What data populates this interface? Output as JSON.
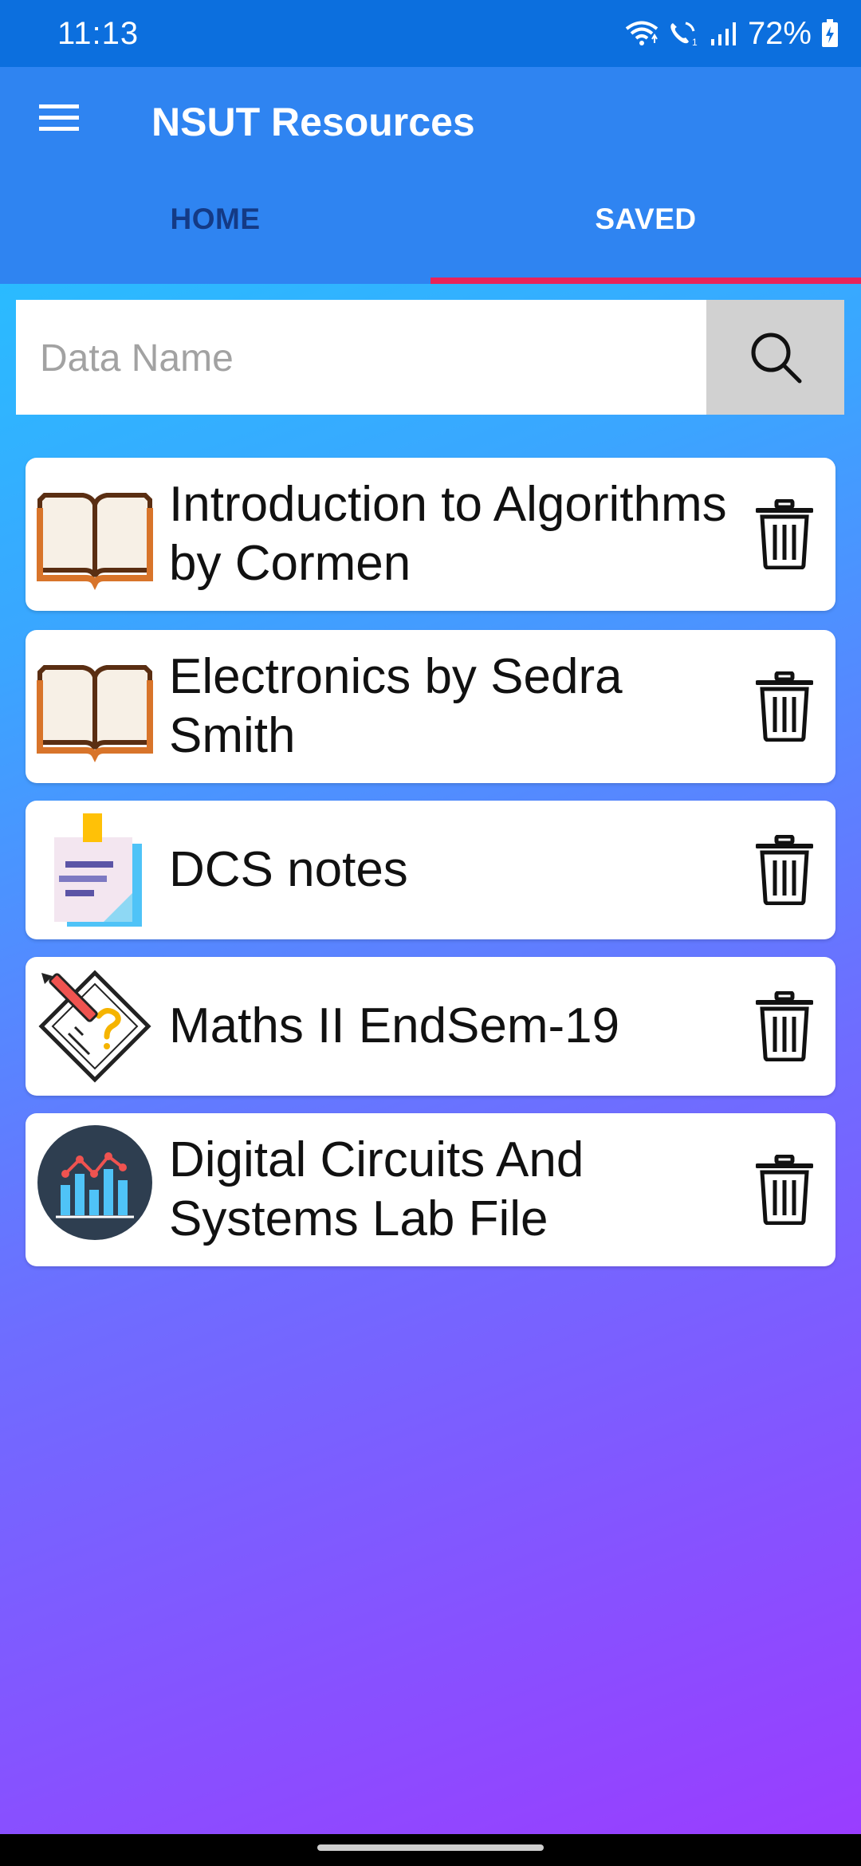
{
  "status_bar": {
    "time": "11:13",
    "battery": "72%",
    "icons": [
      "wifi-icon",
      "wifi-calling-icon",
      "signal-icon",
      "battery-charging-icon"
    ]
  },
  "app_bar": {
    "title": "NSUT Resources",
    "menu_icon": "hamburger-menu-icon",
    "tabs": [
      {
        "label": "HOME",
        "active": false
      },
      {
        "label": "SAVED",
        "active": true
      }
    ],
    "active_indicator_color": "#e8235a"
  },
  "search": {
    "placeholder": "Data Name",
    "value": "",
    "button_icon": "search-icon"
  },
  "saved_items": [
    {
      "title": "Introduction to Algorithms by Cormen",
      "icon": "book-icon"
    },
    {
      "title": "Electronics by  Sedra Smith",
      "icon": "book-icon"
    },
    {
      "title": "DCS notes",
      "icon": "sticky-note-icon"
    },
    {
      "title": "Maths II EndSem-19",
      "icon": "exam-paper-icon"
    },
    {
      "title": "Digital Circuits And Systems Lab File",
      "icon": "chart-icon"
    }
  ],
  "colors": {
    "status_bar": "#0c6fde",
    "app_bar": "#2f84f1",
    "gradient_start": "#1ecbff",
    "gradient_end": "#9b3bff"
  }
}
